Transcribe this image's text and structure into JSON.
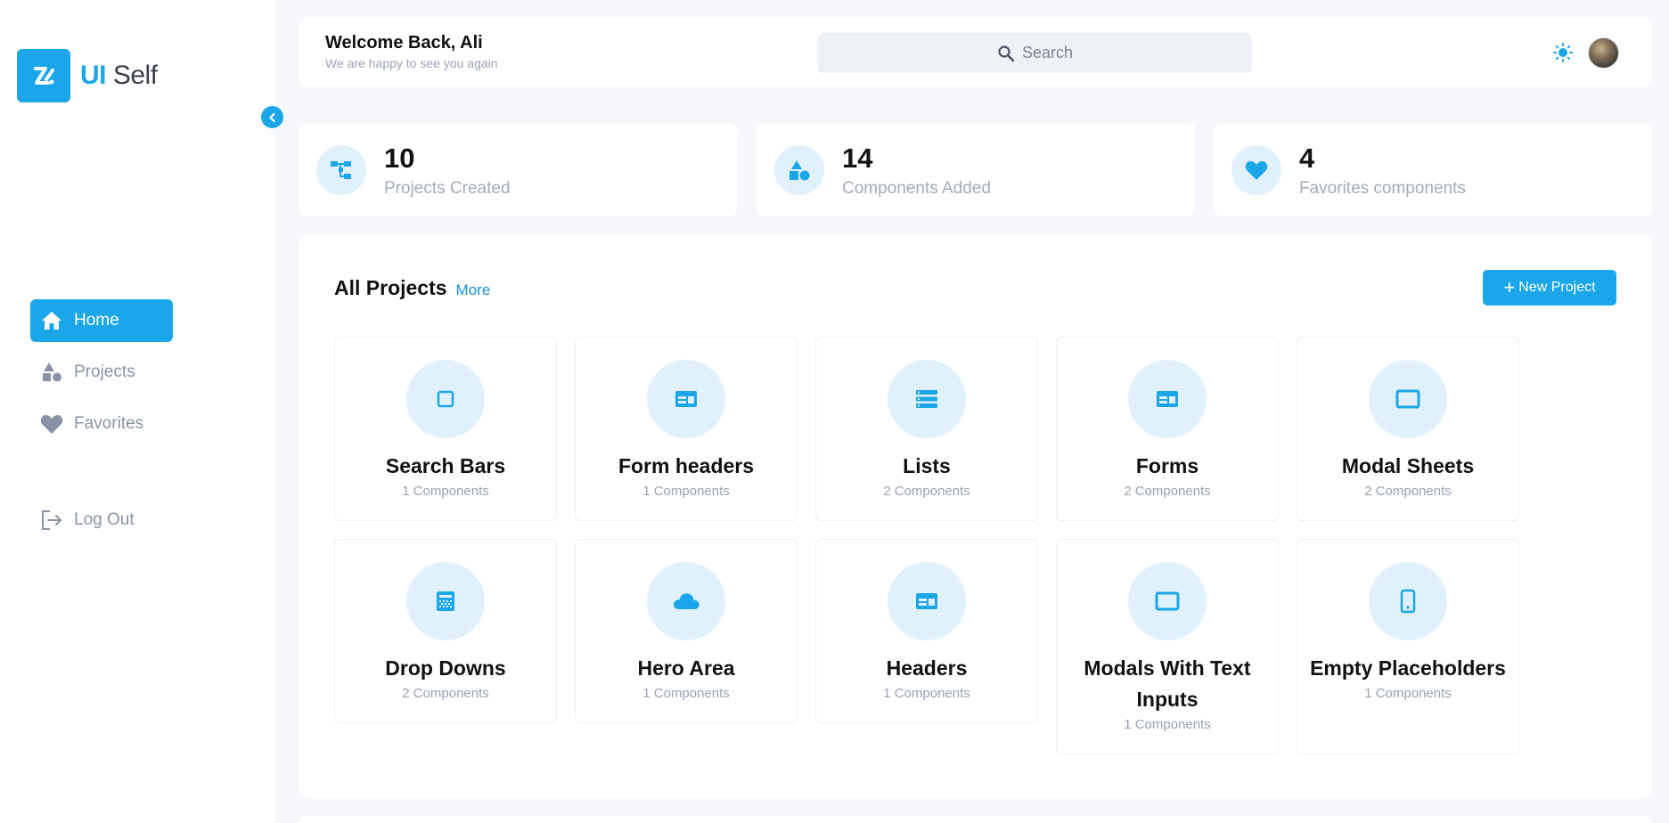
{
  "app": {
    "logo_accent": "UI",
    "logo_name": "Self"
  },
  "sidebar": {
    "items": [
      {
        "label": "Home",
        "icon": "home-icon",
        "active": true
      },
      {
        "label": "Projects",
        "icon": "shapes-icon",
        "active": false
      },
      {
        "label": "Favorites",
        "icon": "heart-icon",
        "active": false
      }
    ],
    "logout_label": "Log Out"
  },
  "header": {
    "welcome_title": "Welcome Back, Ali",
    "welcome_subtitle": "We are happy to see you again",
    "search_placeholder": "Search"
  },
  "stats": [
    {
      "value": "10",
      "label": "Projects Created",
      "icon": "hierarchy-icon"
    },
    {
      "value": "14",
      "label": "Components Added",
      "icon": "shapes-icon"
    },
    {
      "value": "4",
      "label": "Favorites components",
      "icon": "heart-icon"
    }
  ],
  "projects": {
    "title": "All Projects",
    "more_label": "More",
    "new_button_label": "New Project",
    "items": [
      {
        "name": "Search Bars",
        "count": "1 Components",
        "icon": "square-icon"
      },
      {
        "name": "Form headers",
        "count": "1 Components",
        "icon": "form-header-icon"
      },
      {
        "name": "Lists",
        "count": "2 Components",
        "icon": "list-icon"
      },
      {
        "name": "Forms",
        "count": "2 Components",
        "icon": "form-icon"
      },
      {
        "name": "Modal Sheets",
        "count": "2 Components",
        "icon": "modal-icon"
      },
      {
        "name": "Drop Downs",
        "count": "2 Components",
        "icon": "dropdown-icon"
      },
      {
        "name": "Hero Area",
        "count": "1 Components",
        "icon": "cloud-icon"
      },
      {
        "name": "Headers",
        "count": "1 Components",
        "icon": "header-icon"
      },
      {
        "name": "Modals With Text Inputs",
        "count": "1 Components",
        "icon": "modal-input-icon"
      },
      {
        "name": "Empty Placeholders",
        "count": "1 Components",
        "icon": "phone-icon"
      }
    ]
  },
  "colors": {
    "accent": "#1aa6e8",
    "icon_bg": "#e1f1fc",
    "muted": "#9aa2b1"
  }
}
